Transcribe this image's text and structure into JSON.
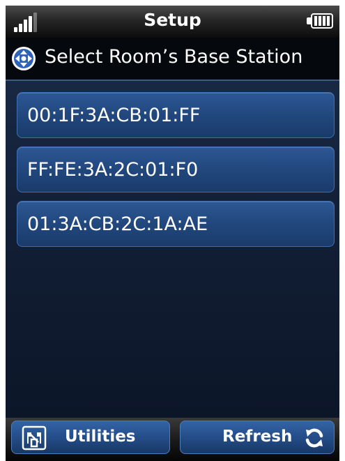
{
  "status_bar": {
    "title": "Setup",
    "signal_icon": "signal-strength-icon",
    "battery_icon": "battery-full-icon"
  },
  "header": {
    "icon": "directional-pad-icon",
    "title": "Select Room’s Base Station"
  },
  "base_stations": [
    "00:1F:3A:CB:01:FF",
    "FF:FE:3A:2C:01:F0",
    "01:3A:CB:2C:1A:AE"
  ],
  "softkeys": {
    "left": {
      "label": "Utilities",
      "icon": "utilities-icon"
    },
    "right": {
      "label": "Refresh",
      "icon": "refresh-icon"
    }
  },
  "colors": {
    "accent": "#2d5895",
    "background": "#111d33",
    "text": "#ffffff"
  }
}
